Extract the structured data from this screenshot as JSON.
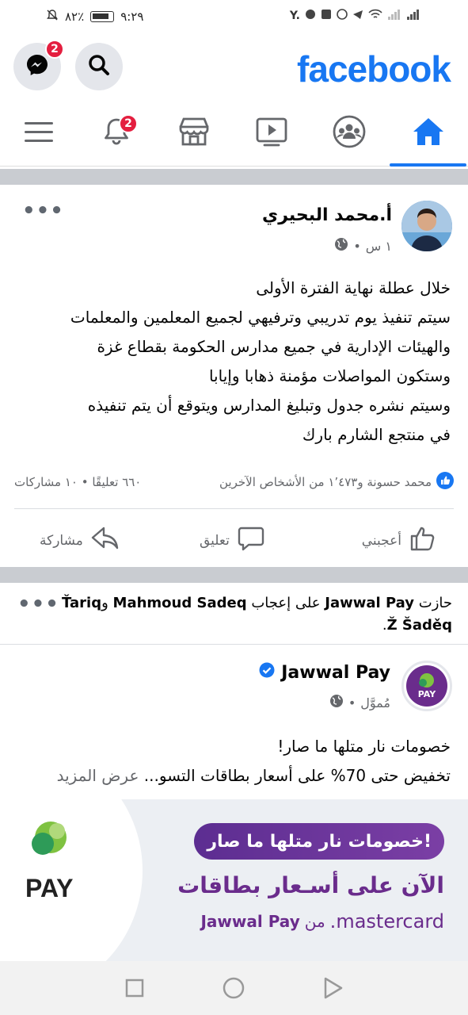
{
  "status_bar": {
    "time": "٩:٢٩",
    "battery": "٨٢٪",
    "right_text": "Y."
  },
  "header": {
    "logo": "facebook",
    "messenger_badge": "2"
  },
  "nav": {
    "notifications_badge": "2"
  },
  "post1": {
    "author": "أ.محمد البحيري",
    "time": "١ س",
    "dot": "•",
    "more": "•••",
    "lines": [
      "خلال عطلة نهاية الفترة الأولى",
      "سيتم تنفيذ يوم تدريبي وترفيهي لجميع المعلمين والمعلمات",
      "والهيئات الإدارية في جميع مدارس الحكومة  بقطاع غزة",
      "وستكون المواصلات مؤمنة ذهابا وإيابا",
      "وسيتم نشره جدول وتبليغ المدارس ويتوقع أن يتم تنفيذه",
      "في منتجع الشارم بارك"
    ],
    "reactions_text": "محمد حسونة و١٬٤٧٣ من الأشخاص الآخرين",
    "counts_text": "٦٦٠ تعليقًا • ١٠ مشاركات",
    "like_label": "أعجبني",
    "comment_label": "تعليق",
    "share_label": "مشاركة"
  },
  "suggested": {
    "text_prefix": "حازت",
    "page_name": "Jawwal Pay",
    "text_middle": "على إعجاب",
    "user1": "Mahmoud Sadeq",
    "conj": "و",
    "user2": "Ťariq Ž Šaděq",
    "end": ".",
    "more": "•••"
  },
  "ad": {
    "page_name": "Jawwal Pay",
    "sponsored": "مُموَّل",
    "dot": "•",
    "avatar_text": "PAY",
    "line1": "خصومات نار متلها ما صار!",
    "line2": "تخفيض حتى 70% على أسعار بطاقات التسو...",
    "see_more": "عرض المزيد",
    "banner_pill": "خصومات نار متلها ما صار!",
    "banner_line2": "الآن على أسـعار بطاقات",
    "banner_brand": "Jawwal Pay",
    "banner_from": "من",
    "banner_card": "mastercard.",
    "banner_logo_text": "PAY"
  },
  "colors": {
    "brand_blue": "#1877f2",
    "badge_red": "#e41e3f",
    "jawwal_purple": "#6a2c8c"
  }
}
